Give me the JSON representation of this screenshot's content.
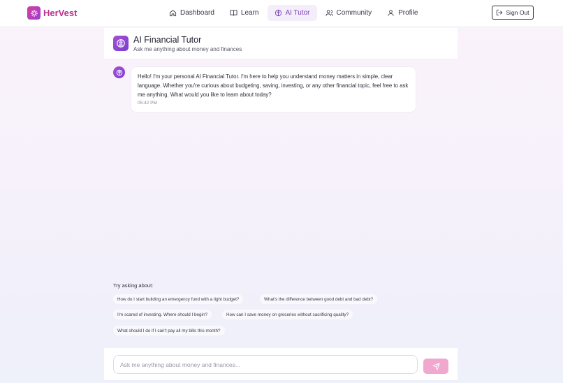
{
  "brand": {
    "name": "HerVest",
    "accent": "#b8338a",
    "logo_icon": "sparkle-icon"
  },
  "nav": {
    "items": [
      {
        "label": "Dashboard",
        "icon": "home-icon",
        "active": false
      },
      {
        "label": "Learn",
        "icon": "book-icon",
        "active": false
      },
      {
        "label": "AI Tutor",
        "icon": "brain-icon",
        "active": true
      },
      {
        "label": "Community",
        "icon": "users-icon",
        "active": false
      },
      {
        "label": "Profile",
        "icon": "user-icon",
        "active": false
      }
    ],
    "sign_out": "Sign Out"
  },
  "header": {
    "title": "AI Financial Tutor",
    "subtitle": "Ask me anything about money and finances",
    "icon": "brain-icon"
  },
  "messages": [
    {
      "sender": "bot",
      "text": "Hello! I'm your personal AI Financial Tutor. I'm here to help you understand money matters in simple, clear language. Whether you're curious about budgeting, saving, investing, or any other financial topic, feel free to ask me anything. What would you like to learn about today?",
      "time": "05:42 PM"
    }
  ],
  "suggestions": {
    "label": "Try asking about:",
    "items": [
      "How do I start building an emergency fund with a tight budget?",
      "What's the difference between good debt and bad debt?",
      "I'm scared of investing. Where should I begin?",
      "How can I save money on groceries without sacrificing quality?",
      "What should I do if I can't pay all my bills this month?"
    ]
  },
  "composer": {
    "placeholder": "Ask me anything about money and finances...",
    "value": "",
    "send_icon": "send-icon",
    "send_color": "#f0a8cf"
  }
}
